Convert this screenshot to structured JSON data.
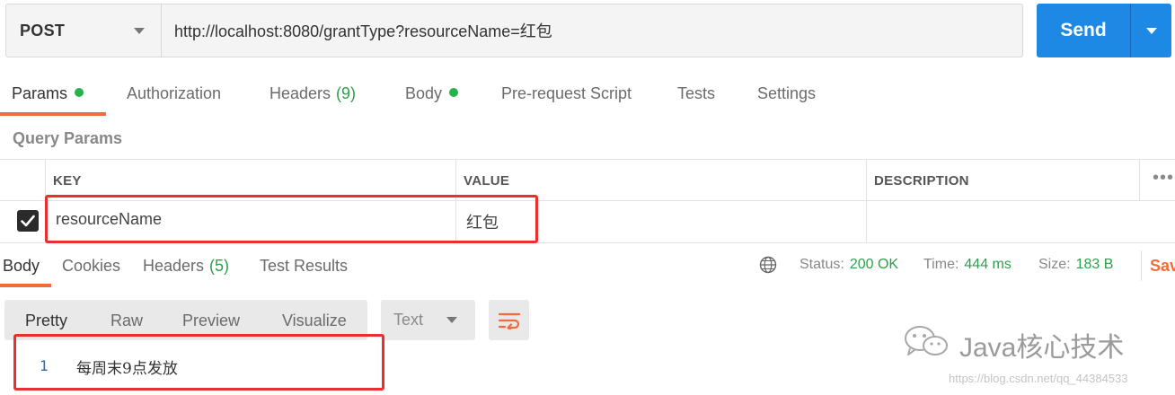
{
  "request": {
    "method": "POST",
    "url": "http://localhost:8080/grantType?resourceName=红包",
    "send_label": "Send"
  },
  "request_tabs": [
    {
      "label": "Params",
      "count": "",
      "dot": true,
      "active": true
    },
    {
      "label": "Authorization",
      "count": ""
    },
    {
      "label": "Headers",
      "count": "(9)"
    },
    {
      "label": "Body",
      "count": "",
      "dot": true
    },
    {
      "label": "Pre-request Script",
      "count": ""
    },
    {
      "label": "Tests",
      "count": ""
    },
    {
      "label": "Settings",
      "count": ""
    }
  ],
  "query_params": {
    "title": "Query Params",
    "columns": [
      "KEY",
      "VALUE",
      "DESCRIPTION"
    ],
    "more": "•••",
    "rows": [
      {
        "checked": true,
        "key": "resourceName",
        "value": "红包",
        "description": ""
      }
    ]
  },
  "response": {
    "tabs": [
      {
        "label": "Body",
        "count": "",
        "active": true
      },
      {
        "label": "Cookies",
        "count": ""
      },
      {
        "label": "Headers",
        "count": "(5)"
      },
      {
        "label": "Test Results",
        "count": ""
      }
    ],
    "status": {
      "label": "Status:",
      "value": "200 OK"
    },
    "time": {
      "label": "Time:",
      "value": "444 ms"
    },
    "size": {
      "label": "Size:",
      "value": "183 B"
    },
    "save_label": "Sav",
    "view_modes": [
      "Pretty",
      "Raw",
      "Preview",
      "Visualize"
    ],
    "active_view": "Pretty",
    "format": "Text",
    "lines": [
      {
        "number": "1",
        "text": "每周末9点发放"
      }
    ]
  },
  "watermark": {
    "title": "Java核心技术",
    "url": "https://blog.csdn.net/qq_44384533"
  },
  "colors": {
    "accent": "#f26b3a",
    "send": "#1e88e5",
    "success": "#2e9f4c",
    "highlight_box": "#e8312e"
  },
  "icons": [
    "chevron-down-icon",
    "globe-icon",
    "wrap-lines-icon",
    "checkmark-icon",
    "more-horizontal-icon",
    "wechat-logo"
  ]
}
